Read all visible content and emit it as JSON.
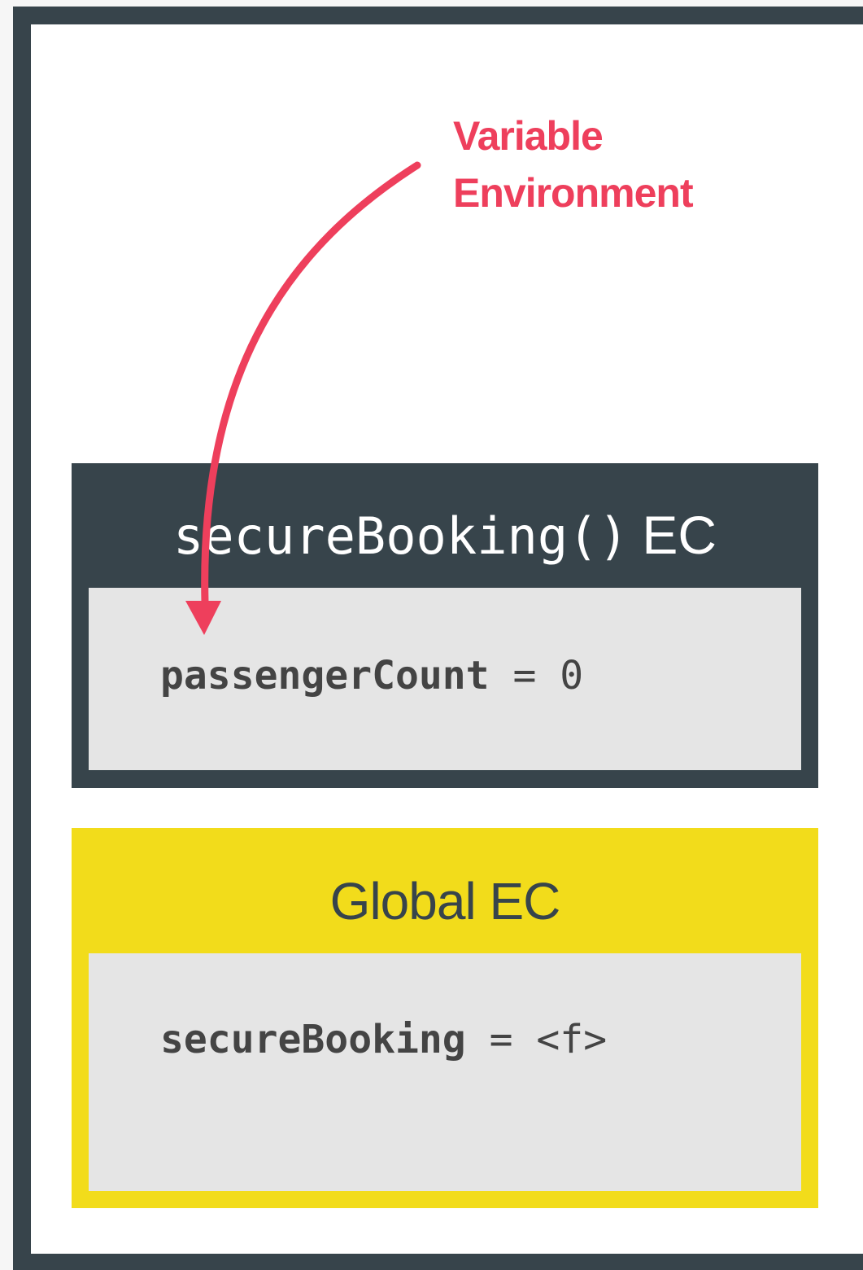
{
  "annotation": {
    "line1": "Variable",
    "line2": "Environment"
  },
  "secure_ec": {
    "title_func": "secureBooking()",
    "title_suffix": "EC",
    "var_name": "passengerCount",
    "var_op": " = ",
    "var_value": "0"
  },
  "global_ec": {
    "title": "Global EC",
    "var_name": "secureBooking",
    "var_op": " = ",
    "var_value": "<f>"
  },
  "colors": {
    "frame": "#37444b",
    "accent": "#ee3f5c",
    "global": "#f2dc1b",
    "panel": "#e5e5e5"
  }
}
